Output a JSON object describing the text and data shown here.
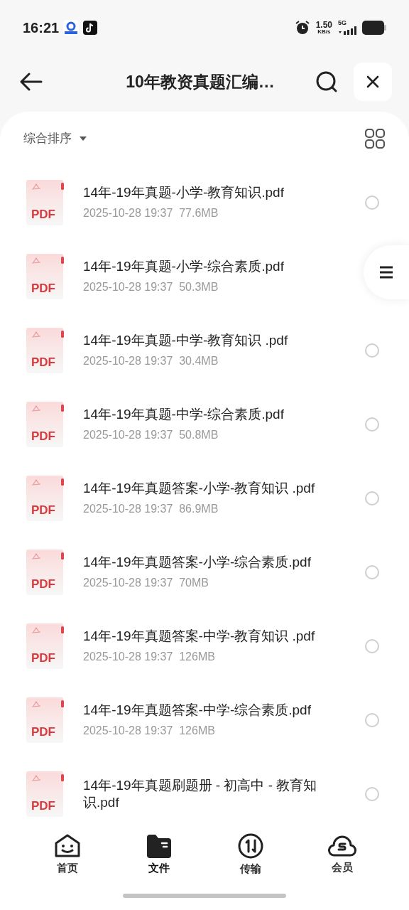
{
  "status_bar": {
    "time": "16:21",
    "speed": "1.50",
    "speed_unit": "KB/s",
    "network": "5G"
  },
  "header": {
    "title": "10年教资真题汇编…"
  },
  "sort": {
    "label": "综合排序"
  },
  "files": [
    {
      "type": "PDF",
      "name": "14年-19年真题-小学-教育知识.pdf",
      "meta": "2025-10-28 19:37  77.6MB",
      "selected": false
    },
    {
      "type": "PDF",
      "name": "14年-19年真题-小学-综合素质.pdf",
      "meta": "2025-10-28 19:37  50.3MB"
    },
    {
      "type": "PDF",
      "name": "14年-19年真题-中学-教育知识 .pdf",
      "meta": "2025-10-28 19:37  30.4MB",
      "selected": false
    },
    {
      "type": "PDF",
      "name": "14年-19年真题-中学-综合素质.pdf",
      "meta": "2025-10-28 19:37  50.8MB",
      "selected": false
    },
    {
      "type": "PDF",
      "name": "14年-19年真题答案-小学-教育知识 .pdf",
      "meta": "2025-10-28 19:37  86.9MB",
      "selected": false
    },
    {
      "type": "PDF",
      "name": "14年-19年真题答案-小学-综合素质.pdf",
      "meta": "2025-10-28 19:37  70MB",
      "selected": false
    },
    {
      "type": "PDF",
      "name": "14年-19年真题答案-中学-教育知识 .pdf",
      "meta": "2025-10-28 19:37  126MB",
      "selected": false
    },
    {
      "type": "PDF",
      "name": "14年-19年真题答案-中学-综合素质.pdf",
      "meta": "2025-10-28 19:37  126MB",
      "selected": false
    },
    {
      "type": "PDF",
      "name": "14年-19年真题刷题册 - 初高中 - 教育知识.pdf",
      "selected": false
    }
  ],
  "nav": [
    {
      "label": "首页",
      "kind": "home",
      "selected": false
    },
    {
      "label": "文件",
      "kind": "files",
      "selected": true
    },
    {
      "label": "传输",
      "kind": "transfer",
      "selected": false
    },
    {
      "label": "会员",
      "kind": "member",
      "selected": false
    }
  ]
}
